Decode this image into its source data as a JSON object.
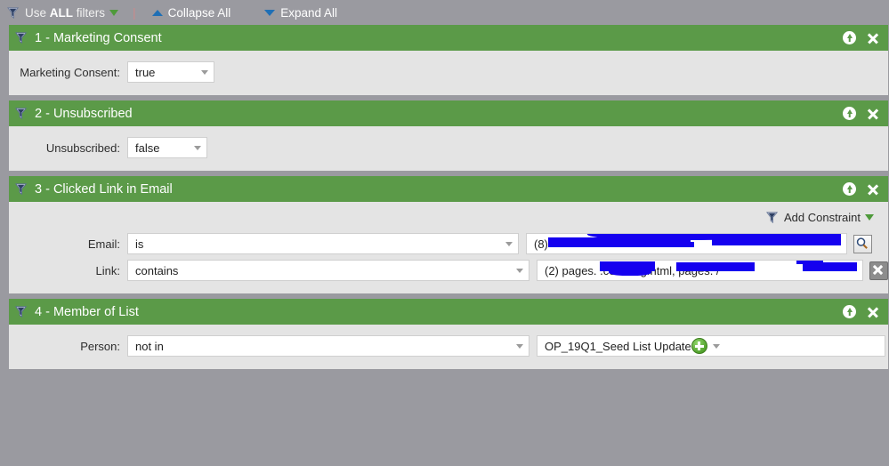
{
  "toolbar": {
    "filter_icon": "funnel-icon",
    "use_label_pre": "Use ",
    "use_label_strong": "ALL",
    "use_label_post": " filters",
    "separator": "|",
    "collapse_all": "Collapse All",
    "expand_all": "Expand All"
  },
  "panels": [
    {
      "title": "1 - Marketing Consent",
      "icon": "funnel-icon",
      "collapse_icon": "up-arrow-circle-icon",
      "close_icon": "close-icon",
      "rows": [
        {
          "label": "Marketing Consent:",
          "operator": "true"
        }
      ]
    },
    {
      "title": "2 - Unsubscribed",
      "icon": "funnel-icon",
      "collapse_icon": "up-arrow-circle-icon",
      "close_icon": "close-icon",
      "rows": [
        {
          "label": "Unsubscribed:",
          "operator": "false"
        }
      ]
    },
    {
      "title": "3 - Clicked Link in Email",
      "icon": "funnel-icon",
      "collapse_icon": "up-arrow-circle-icon",
      "close_icon": "close-icon",
      "add_constraint_label": "Add Constraint",
      "rows": [
        {
          "label": "Email:",
          "operator": "is",
          "value": "(8)",
          "value_redacted": true,
          "action_icon": "search-icon"
        },
        {
          "label": "Link:",
          "operator": "contains",
          "value": "(2) pages.           .com/ai              g.html, pages.                    /",
          "value_redacted": true,
          "action_icon": "remove-constraint-icon"
        }
      ]
    },
    {
      "title": "4 - Member of List",
      "icon": "funnel-icon",
      "collapse_icon": "up-arrow-circle-icon",
      "close_icon": "close-icon",
      "rows": [
        {
          "label": "Person:",
          "operator": "not in",
          "value": "OP_19Q1_Seed List Update",
          "add_icon": "add-list-icon"
        }
      ]
    }
  ],
  "colors": {
    "panel_header_green": "#5b9a48",
    "toolbar_gray": "#9a9aa0",
    "body_gray": "#e2e2e2",
    "redaction_blue": "#1500ef",
    "link_blue": "#1f6fb5"
  }
}
